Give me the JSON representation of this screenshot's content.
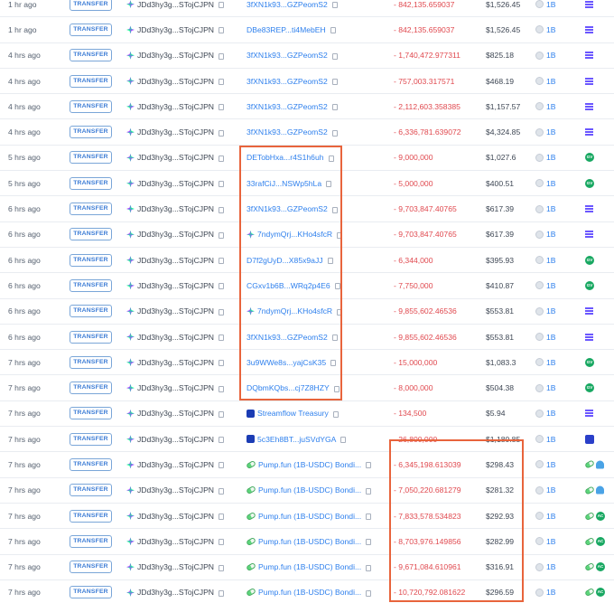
{
  "copy_icon": "copy-icon",
  "highlight_color": "#e8643c",
  "rows": [
    {
      "time": "1 hr ago",
      "type": "TRANSFER",
      "from": "JDd3hy3g...STojCJPN",
      "to": "3fXN1k93...GZPeomS2",
      "to_icon": "",
      "amount": "- 842,135.659037",
      "value": "$1,526.45",
      "token": "1B",
      "platform": "lines"
    },
    {
      "time": "1 hr ago",
      "type": "TRANSFER",
      "from": "JDd3hy3g...STojCJPN",
      "to": "DBe83REP...ti4MebEH",
      "to_icon": "",
      "amount": "- 842,135.659037",
      "value": "$1,526.45",
      "token": "1B",
      "platform": "lines"
    },
    {
      "time": "4 hrs ago",
      "type": "TRANSFER",
      "from": "JDd3hy3g...STojCJPN",
      "to": "3fXN1k93...GZPeomS2",
      "to_icon": "",
      "amount": "- 1,740,472.977311",
      "value": "$825.18",
      "token": "1B",
      "platform": "lines"
    },
    {
      "time": "4 hrs ago",
      "type": "TRANSFER",
      "from": "JDd3hy3g...STojCJPN",
      "to": "3fXN1k93...GZPeomS2",
      "to_icon": "",
      "amount": "- 757,003.317571",
      "value": "$468.19",
      "token": "1B",
      "platform": "lines"
    },
    {
      "time": "4 hrs ago",
      "type": "TRANSFER",
      "from": "JDd3hy3g...STojCJPN",
      "to": "3fXN1k93...GZPeomS2",
      "to_icon": "",
      "amount": "- 2,112,603.358385",
      "value": "$1,157.57",
      "token": "1B",
      "platform": "lines"
    },
    {
      "time": "4 hrs ago",
      "type": "TRANSFER",
      "from": "JDd3hy3g...STojCJPN",
      "to": "3fXN1k93...GZPeomS2",
      "to_icon": "",
      "amount": "- 6,336,781.639072",
      "value": "$4,324.85",
      "token": "1B",
      "platform": "lines"
    },
    {
      "time": "5 hrs ago",
      "type": "TRANSFER",
      "from": "JDd3hy3g...STojCJPN",
      "to": "DETobHxa...r4S1h6uh",
      "to_icon": "",
      "amount": "- 9,000,000",
      "value": "$1,027.6",
      "token": "1B",
      "platform": "green"
    },
    {
      "time": "5 hrs ago",
      "type": "TRANSFER",
      "from": "JDd3hy3g...STojCJPN",
      "to": "33rafCiJ...NSWp5hLa",
      "to_icon": "",
      "amount": "- 5,000,000",
      "value": "$400.51",
      "token": "1B",
      "platform": "green"
    },
    {
      "time": "6 hrs ago",
      "type": "TRANSFER",
      "from": "JDd3hy3g...STojCJPN",
      "to": "3fXN1k93...GZPeomS2",
      "to_icon": "",
      "amount": "- 9,703,847.40765",
      "value": "$617.39",
      "token": "1B",
      "platform": "lines"
    },
    {
      "time": "6 hrs ago",
      "type": "TRANSFER",
      "from": "JDd3hy3g...STojCJPN",
      "to": "7ndymQrj...KHo4sfcR",
      "to_icon": "sol",
      "amount": "- 9,703,847.40765",
      "value": "$617.39",
      "token": "1B",
      "platform": "lines"
    },
    {
      "time": "6 hrs ago",
      "type": "TRANSFER",
      "from": "JDd3hy3g...STojCJPN",
      "to": "D7f2gUyD...X85x9aJJ",
      "to_icon": "",
      "amount": "- 6,344,000",
      "value": "$395.93",
      "token": "1B",
      "platform": "green"
    },
    {
      "time": "6 hrs ago",
      "type": "TRANSFER",
      "from": "JDd3hy3g...STojCJPN",
      "to": "CGxv1b6B...WRq2p4E6",
      "to_icon": "",
      "amount": "- 7,750,000",
      "value": "$410.87",
      "token": "1B",
      "platform": "green"
    },
    {
      "time": "6 hrs ago",
      "type": "TRANSFER",
      "from": "JDd3hy3g...STojCJPN",
      "to": "7ndymQrj...KHo4sfcR",
      "to_icon": "sol",
      "amount": "- 9,855,602.46536",
      "value": "$553.81",
      "token": "1B",
      "platform": "lines"
    },
    {
      "time": "6 hrs ago",
      "type": "TRANSFER",
      "from": "JDd3hy3g...STojCJPN",
      "to": "3fXN1k93...GZPeomS2",
      "to_icon": "",
      "amount": "- 9,855,602.46536",
      "value": "$553.81",
      "token": "1B",
      "platform": "lines"
    },
    {
      "time": "7 hrs ago",
      "type": "TRANSFER",
      "from": "JDd3hy3g...STojCJPN",
      "to": "3u9WWe8s...yajCsK35",
      "to_icon": "",
      "amount": "- 15,000,000",
      "value": "$1,083.3",
      "token": "1B",
      "platform": "green"
    },
    {
      "time": "7 hrs ago",
      "type": "TRANSFER",
      "from": "JDd3hy3g...STojCJPN",
      "to": "DQbmKQbs...cj7Z8HZY",
      "to_icon": "",
      "amount": "- 8,000,000",
      "value": "$504.38",
      "token": "1B",
      "platform": "green"
    },
    {
      "time": "7 hrs ago",
      "type": "TRANSFER",
      "from": "JDd3hy3g...STojCJPN",
      "to": "Streamflow Treasury",
      "to_icon": "sf",
      "amount": "- 134,500",
      "value": "$5.94",
      "token": "1B",
      "platform": "lines"
    },
    {
      "time": "7 hrs ago",
      "type": "TRANSFER",
      "from": "JDd3hy3g...STojCJPN",
      "to": "5c3Eh8BT...juSVdYGA",
      "to_icon": "sf",
      "amount": "- 26,800,000",
      "value": "$1,180.85",
      "token": "1B",
      "platform": "blue"
    },
    {
      "time": "7 hrs ago",
      "type": "TRANSFER",
      "from": "JDd3hy3g...STojCJPN",
      "to": "Pump.fun (1B-USDC) Bondi...",
      "to_icon": "pump",
      "amount": "- 6,345,198.613039",
      "value": "$298.43",
      "token": "1B",
      "platform": "pump-cat"
    },
    {
      "time": "7 hrs ago",
      "type": "TRANSFER",
      "from": "JDd3hy3g...STojCJPN",
      "to": "Pump.fun (1B-USDC) Bondi...",
      "to_icon": "pump",
      "amount": "- 7,050,220.681279",
      "value": "$281.32",
      "token": "1B",
      "platform": "pump-cat"
    },
    {
      "time": "7 hrs ago",
      "type": "TRANSFER",
      "from": "JDd3hy3g...STojCJPN",
      "to": "Pump.fun (1B-USDC) Bondi...",
      "to_icon": "pump",
      "amount": "- 7,833,578.534823",
      "value": "$292.93",
      "token": "1B",
      "platform": "pump-ac"
    },
    {
      "time": "7 hrs ago",
      "type": "TRANSFER",
      "from": "JDd3hy3g...STojCJPN",
      "to": "Pump.fun (1B-USDC) Bondi...",
      "to_icon": "pump",
      "amount": "- 8,703,976.149856",
      "value": "$282.99",
      "token": "1B",
      "platform": "pump-ac"
    },
    {
      "time": "7 hrs ago",
      "type": "TRANSFER",
      "from": "JDd3hy3g...STojCJPN",
      "to": "Pump.fun (1B-USDC) Bondi...",
      "to_icon": "pump",
      "amount": "- 9,671,084.610961",
      "value": "$316.91",
      "token": "1B",
      "platform": "pump-ac"
    },
    {
      "time": "7 hrs ago",
      "type": "TRANSFER",
      "from": "JDd3hy3g...STojCJPN",
      "to": "Pump.fun (1B-USDC) Bondi...",
      "to_icon": "pump",
      "amount": "- 10,720,792.081622",
      "value": "$296.59",
      "token": "1B",
      "platform": "pump-ac"
    }
  ],
  "platform_labels": {
    "green": "GV",
    "ac": "AC"
  }
}
